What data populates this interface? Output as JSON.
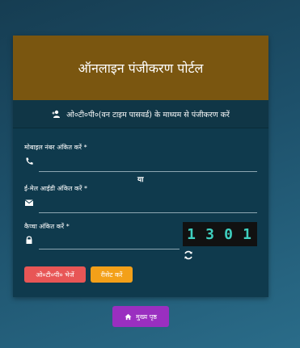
{
  "header": {
    "title": "ऑनलाइन पंजीकरण पोर्टल"
  },
  "subheader": {
    "text": "ओ०टी०पी०(वन टाइम पासवर्ड) के माध्यम से पंजीकरण करें",
    "icon": "user-plus-icon"
  },
  "fields": {
    "mobile": {
      "label": "मोबाइल नंबर अंकित करें *",
      "icon": "phone-icon",
      "value": ""
    },
    "email": {
      "label": "ई-मेल आईडी अंकित करें *",
      "icon": "envelope-icon",
      "value": ""
    },
    "captcha": {
      "label": "कैप्चा अंकित करें *",
      "icon": "lock-icon",
      "value": ""
    }
  },
  "separator": "या",
  "captcha_image": {
    "code": [
      "1",
      "3",
      "0",
      "1"
    ]
  },
  "buttons": {
    "send_otp": "ओ०टी०पी० भेजें",
    "reset": "रीसेट करें"
  },
  "footer": {
    "home_label": "मुख्य पृष्ठ",
    "home_icon": "home-icon"
  },
  "colors": {
    "header_bg": "#7a5610",
    "card_bg": "#0f3a4d",
    "send_otp": "#e85656",
    "reset": "#f3a019",
    "home": "#9a2fc0",
    "captcha_text": "#3fd0c0"
  }
}
